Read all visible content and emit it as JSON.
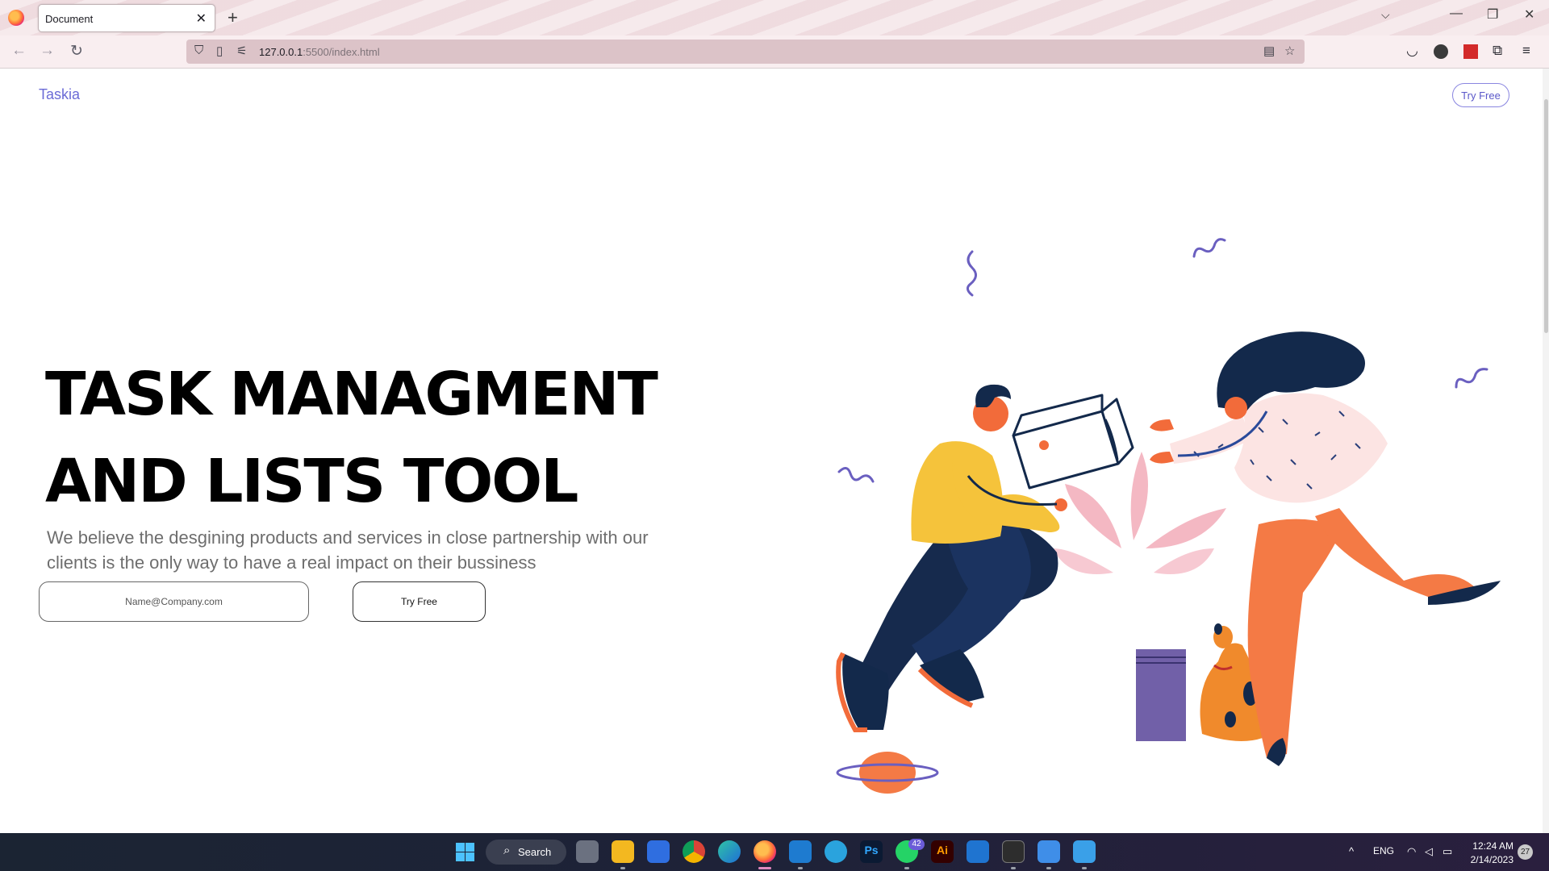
{
  "browser": {
    "tab_title": "Document",
    "tab_close": "✕",
    "new_tab": "+",
    "list_tabs": "⌵",
    "minimize": "—",
    "restore": "❐",
    "close": "✕",
    "back": "←",
    "forward": "→",
    "reload": "↻",
    "url_host": "127.0.0.1",
    "url_path": ":5500/index.html",
    "icons": [
      "firefox-logo-icon",
      "shield-icon",
      "page-icon",
      "permissions-icon",
      "reader-view-icon",
      "bookmark-star-icon",
      "pocket-icon",
      "account-icon",
      "extension-icon",
      "puzzle-icon",
      "menu-icon"
    ]
  },
  "page": {
    "brand": "Taskia",
    "top_cta": "Try Free",
    "hero_title_line1": "TASK MANAGMENT",
    "hero_title_line2": "AND LISTS TOOL",
    "hero_text": "We believe the desgining products and services in close partnership with our clients is the only way to have a real impact on their bussiness",
    "email_placeholder": "Name@Company.com",
    "hero_cta": "Try Free",
    "colors": {
      "brand": "#6b6bd6",
      "yellow_shirt": "#f5c33b",
      "navy": "#162a4d",
      "coral": "#f26b3a",
      "pink_leaf": "#f4b8c3",
      "pot": "#7160a8",
      "dog": "#f08a2c"
    }
  },
  "taskbar": {
    "search_label": "Search",
    "apps": [
      "task-view",
      "file-explorer",
      "microsoft-store",
      "chrome",
      "edge",
      "firefox",
      "vscode",
      "telegram",
      "photoshop",
      "whatsapp",
      "illustrator",
      "mail",
      "terminal",
      "paint",
      "notepad"
    ],
    "ps_label": "Ps",
    "ai_label": "Ai",
    "whatsapp_badge": "42",
    "tray_chevron": "^",
    "language": "ENG",
    "time": "12:24 AM",
    "date": "2/14/2023",
    "notifications": "27"
  }
}
